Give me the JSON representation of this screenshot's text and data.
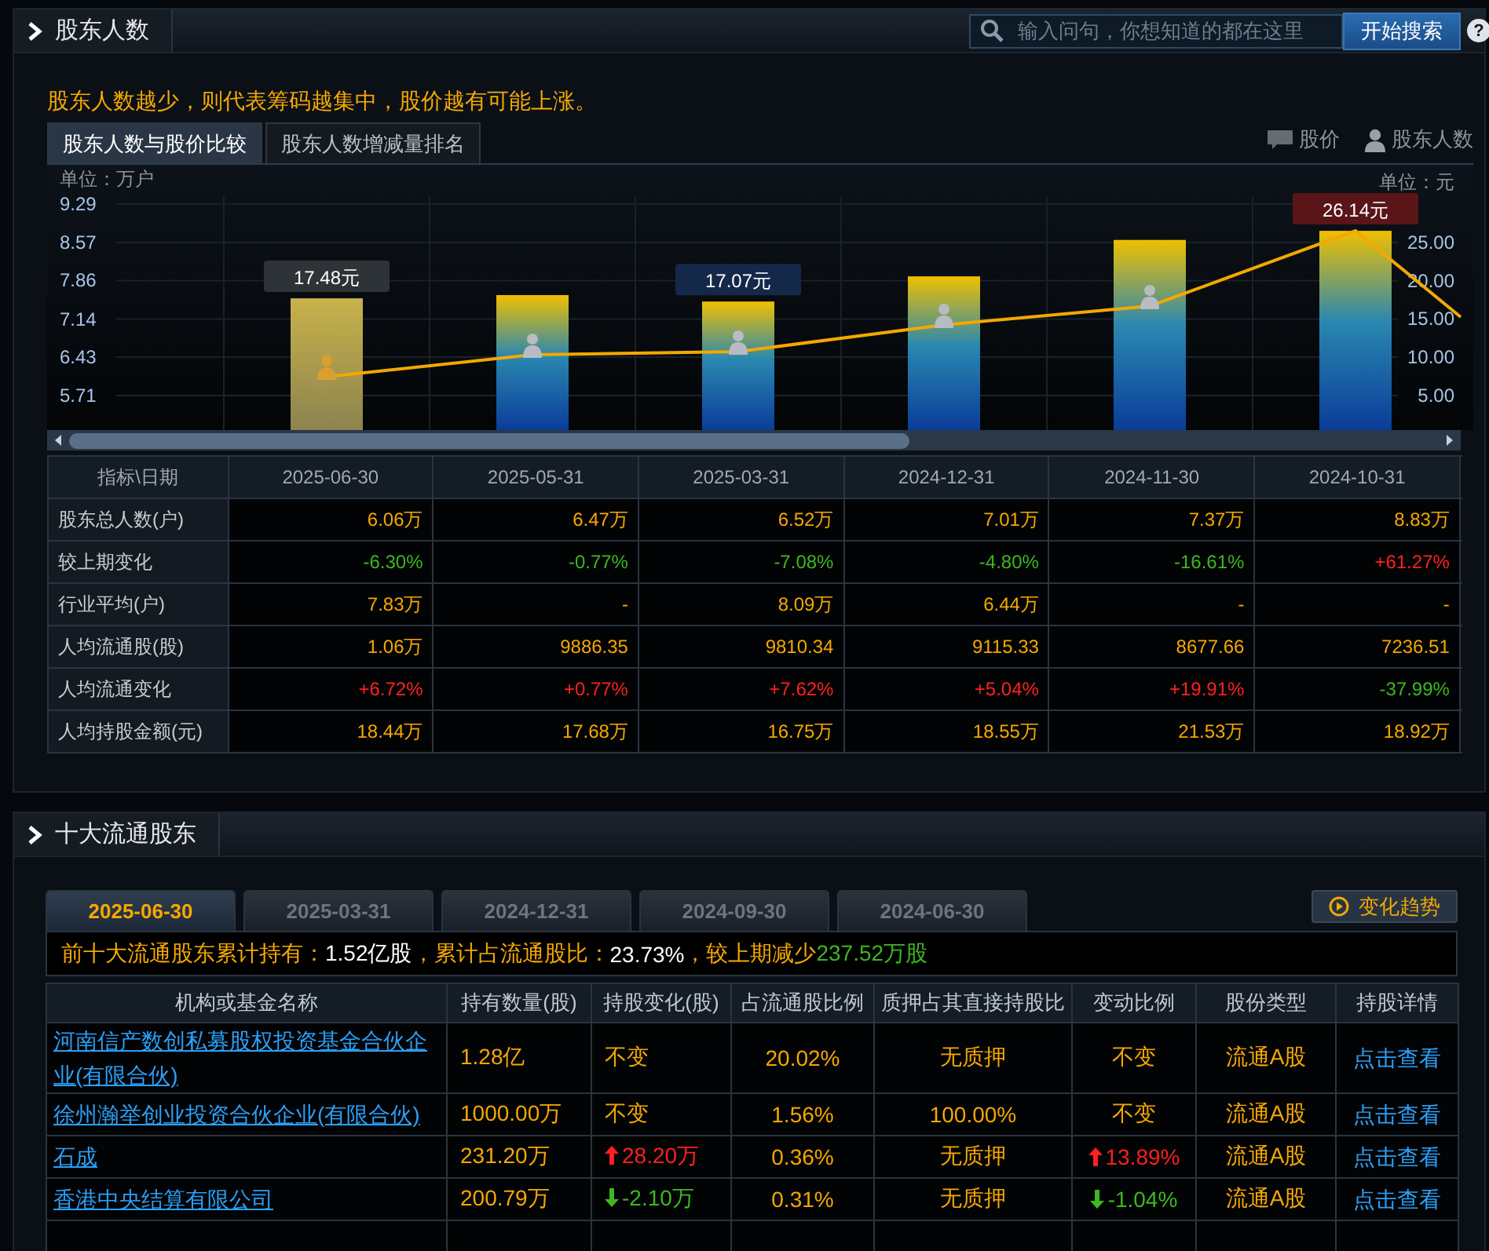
{
  "section1": {
    "title": "股东人数",
    "search": {
      "placeholder": "输入问句，你想知道的都在这里",
      "button": "开始搜索",
      "help": "?"
    },
    "note": "股东人数越少，则代表筹码越集中，股价越有可能上涨。",
    "tabs": [
      {
        "label": "股东人数与股价比较",
        "selected": true
      },
      {
        "label": "股东人数增减量排名",
        "selected": false
      }
    ],
    "legend": [
      "股价",
      "股东人数"
    ],
    "left_unit": "单位：万户",
    "right_unit": "单位：元",
    "left_ticks": [
      "9.29",
      "8.57",
      "7.86",
      "7.14",
      "6.43",
      "5.71"
    ],
    "right_ticks": [
      "25.00",
      "20.00",
      "15.00",
      "10.00",
      "5.00"
    ],
    "price_tags": [
      {
        "text": "17.48元",
        "kind": "grey"
      },
      {
        "text": "17.07元",
        "kind": "blue"
      },
      {
        "text": "26.14元",
        "kind": "red"
      }
    ],
    "table": {
      "corner": "指标\\日期",
      "dates": [
        "2025-06-30",
        "2025-05-31",
        "2025-03-31",
        "2024-12-31",
        "2024-11-30",
        "2024-10-31"
      ],
      "rows": [
        {
          "label": "股东总人数(户)",
          "kind": "value",
          "cells": [
            "6.06万",
            "6.47万",
            "6.52万",
            "7.01万",
            "7.37万",
            "8.83万"
          ]
        },
        {
          "label": "较上期变化",
          "kind": "change",
          "cells": [
            {
              "text": "-6.30%",
              "kind": "down"
            },
            {
              "text": "-0.77%",
              "kind": "down"
            },
            {
              "text": "-7.08%",
              "kind": "down"
            },
            {
              "text": "-4.80%",
              "kind": "down"
            },
            {
              "text": "-16.61%",
              "kind": "down"
            },
            {
              "text": "+61.27%",
              "kind": "up"
            }
          ]
        },
        {
          "label": "行业平均(户)",
          "kind": "value",
          "cells": [
            "7.83万",
            "-",
            "8.09万",
            "6.44万",
            "-",
            "-"
          ]
        },
        {
          "label": "人均流通股(股)",
          "kind": "value",
          "cells": [
            "1.06万",
            "9886.35",
            "9810.34",
            "9115.33",
            "8677.66",
            "7236.51"
          ]
        },
        {
          "label": "人均流通变化",
          "kind": "change",
          "cells": [
            {
              "text": "+6.72%",
              "kind": "up"
            },
            {
              "text": "+0.77%",
              "kind": "up"
            },
            {
              "text": "+7.62%",
              "kind": "up"
            },
            {
              "text": "+5.04%",
              "kind": "up"
            },
            {
              "text": "+19.91%",
              "kind": "up"
            },
            {
              "text": "-37.99%",
              "kind": "down"
            }
          ]
        },
        {
          "label": "人均持股金额(元)",
          "kind": "value",
          "cells": [
            "18.44万",
            "17.68万",
            "16.75万",
            "18.55万",
            "21.53万",
            "18.92万"
          ]
        }
      ]
    }
  },
  "section2": {
    "title": "十大流通股东",
    "tabs": [
      {
        "label": "2025-06-30",
        "selected": true
      },
      {
        "label": "2025-03-31",
        "selected": false
      },
      {
        "label": "2024-12-31",
        "selected": false
      },
      {
        "label": "2024-09-30",
        "selected": false
      },
      {
        "label": "2024-06-30",
        "selected": false
      }
    ],
    "trend_button": "变化趋势",
    "summary": [
      {
        "text": "前十大流通股东累计持有：",
        "kind": "label"
      },
      {
        "text": "1.52亿股",
        "kind": "value"
      },
      {
        "text": "，累计占流通股比：",
        "kind": "label"
      },
      {
        "text": "23.73%",
        "kind": "value"
      },
      {
        "text": " ，较上期减少",
        "kind": "label"
      },
      {
        "text": "237.52万股",
        "kind": "down"
      }
    ],
    "columns": [
      "机构或基金名称",
      "持有数量(股)",
      "持股变化(股)",
      "占流通股比例",
      "质押占其直接持股比",
      "变动比例",
      "股份类型",
      "持股详情"
    ],
    "rows": [
      {
        "name": "河南信产数创私募股权投资基金合伙企业(有限合伙)",
        "shares": "1.28亿",
        "change": {
          "text": "不变",
          "kind": "same"
        },
        "ratio": "20.02%",
        "pledge": "无质押",
        "change_ratio": {
          "text": "不变",
          "kind": "same"
        },
        "type": "流通A股",
        "detail": "点击查看"
      },
      {
        "name": "徐州瀚举创业投资合伙企业(有限合伙)",
        "shares": "1000.00万",
        "change": {
          "text": "不变",
          "kind": "same"
        },
        "ratio": "1.56%",
        "pledge": "100.00%",
        "change_ratio": {
          "text": "不变",
          "kind": "same"
        },
        "type": "流通A股",
        "detail": "点击查看"
      },
      {
        "name": "石成",
        "shares": "231.20万",
        "change": {
          "text": "28.20万",
          "kind": "up"
        },
        "ratio": "0.36%",
        "pledge": "无质押",
        "change_ratio": {
          "text": "13.89%",
          "kind": "up"
        },
        "type": "流通A股",
        "detail": "点击查看"
      },
      {
        "name": "香港中央结算有限公司",
        "shares": "200.79万",
        "change": {
          "text": "-2.10万",
          "kind": "down"
        },
        "ratio": "0.31%",
        "pledge": "无质押",
        "change_ratio": {
          "text": "-1.04%",
          "kind": "down"
        },
        "type": "流通A股",
        "detail": "点击查看"
      }
    ]
  }
}
